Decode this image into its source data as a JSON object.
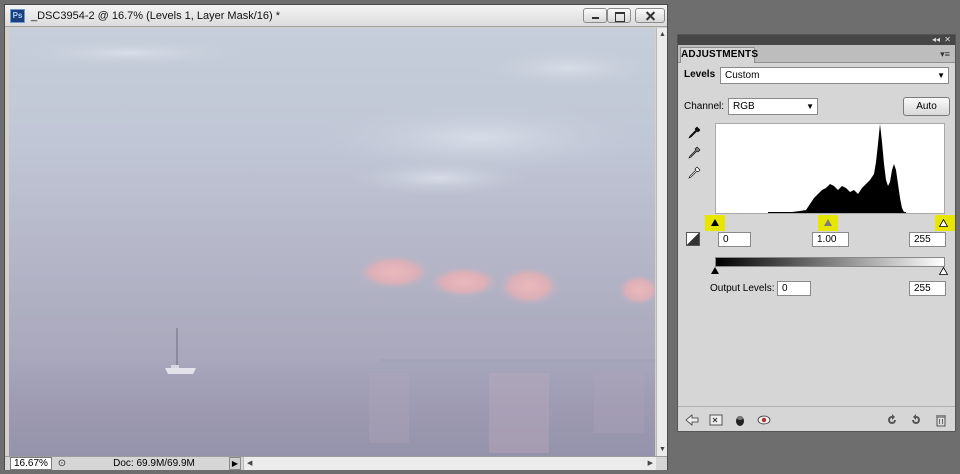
{
  "document": {
    "title": "_DSC3954-2 @ 16.7% (Levels 1, Layer Mask/16) *",
    "app_icon": "Ps",
    "zoom": "16.67%",
    "doc_info": "Doc: 69.9M/69.9M"
  },
  "adjustments": {
    "tab_label": "ADJUSTMENTS",
    "levels_label": "Levels",
    "preset_value": "Custom",
    "channel_label": "Channel:",
    "channel_value": "RGB",
    "auto_label": "Auto",
    "input_black": "0",
    "input_gamma": "1.00",
    "input_white": "255",
    "output_label": "Output Levels:",
    "output_black": "0",
    "output_white": "255"
  },
  "colors": {
    "highlight": "#e6e600",
    "panel_bg": "#d6d6d6",
    "titlebar": "#dcdcdc"
  },
  "icons": [
    "photoshop-icon",
    "minimize-icon",
    "maximize-icon",
    "close-icon",
    "black-eyedropper-icon",
    "gray-eyedropper-icon",
    "white-eyedropper-icon",
    "clipping-icon",
    "back-arrow-icon",
    "clip-to-layer-icon",
    "visibility-icon",
    "view-previous-icon",
    "reset-icon",
    "delete-icon"
  ]
}
